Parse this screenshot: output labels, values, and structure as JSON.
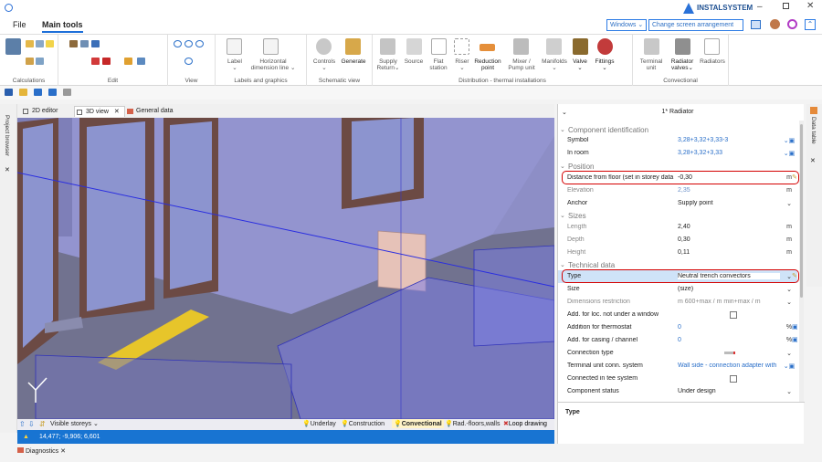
{
  "app": {
    "name": "INSTALSYSTEM"
  },
  "menu": {
    "file": "File",
    "main_tools": "Main tools",
    "windows": "Windows",
    "change_screen": "Change screen arrangement"
  },
  "ribbon": {
    "groups": [
      "Calculations",
      "Edit",
      "View",
      "Labels and graphics",
      "Schematic view",
      "Distribution - thermal installations",
      "Convectional"
    ],
    "buttons": {
      "label": "Label",
      "horizontal_dim_1": "Horizontal",
      "horizontal_dim_2": "dimension line",
      "controls": "Controls",
      "generate": "Generate",
      "supply_return_1": "Supply",
      "supply_return_2": "Return",
      "source": "Source",
      "flat_station_1": "Flat",
      "flat_station_2": "station",
      "riser": "Riser",
      "reduction_point_1": "Reduction",
      "reduction_point_2": "point",
      "mixer_1": "Mixer /",
      "mixer_2": "Pump unit",
      "manifolds": "Manifolds",
      "valve": "Valve",
      "fittings": "Fittings",
      "terminal_unit_1": "Terminal",
      "terminal_unit_2": "unit",
      "radiator_valves_1": "Radiator",
      "radiator_valves_2": "valves",
      "radiators": "Radiators"
    }
  },
  "tabs": [
    {
      "label": "2D editor"
    },
    {
      "label": "3D view"
    },
    {
      "label": "General data"
    }
  ],
  "left_panel": {
    "project_browser": "Project browser"
  },
  "right_panel": {
    "data_table": "Data table"
  },
  "viewport_status": {
    "visible_storeys": "Visible storeys",
    "layers": [
      "Underlay",
      "Construction",
      "Convectional",
      "Rad.-floors,walls",
      "Loop drawing"
    ]
  },
  "status_bar": {
    "coordinates": "14,477; -9,906; 6,601"
  },
  "diagnostics": {
    "label": "Diagnostics"
  },
  "properties": {
    "header": "1* Radiator",
    "sections": {
      "component_identification": "Component identification",
      "position": "Position",
      "sizes": "Sizes",
      "technical_data": "Technical data"
    },
    "rows": {
      "symbol": {
        "label": "Symbol",
        "value": "3,28+3,32+3,33-3"
      },
      "in_room": {
        "label": "In room",
        "value": "3,28+3,32+3,33"
      },
      "distance_from_floor": {
        "label": "Distance from floor (set in storey data",
        "value": "-0,30",
        "unit": "m"
      },
      "elevation": {
        "label": "Elevation",
        "value": "2,35",
        "unit": "m"
      },
      "anchor": {
        "label": "Anchor",
        "value": "Supply point"
      },
      "length": {
        "label": "Length",
        "value": "2,40",
        "unit": "m"
      },
      "depth": {
        "label": "Depth",
        "value": "0,30",
        "unit": "m"
      },
      "height": {
        "label": "Height",
        "value": "0,11",
        "unit": "m"
      },
      "type": {
        "label": "Type",
        "value": "Neutral trench convectors"
      },
      "size": {
        "label": "Size",
        "value": "(size)"
      },
      "dimensions_restriction": {
        "label": "Dimensions restriction",
        "value": "m 600+max / m min+max / m"
      },
      "add_loc": {
        "label": "Add. for loc. not under a window"
      },
      "addition_thermostat": {
        "label": "Addition for thermostat",
        "value": "0",
        "unit": "%"
      },
      "add_casing": {
        "label": "Add. for casing / channel",
        "value": "0",
        "unit": "%"
      },
      "connection_type": {
        "label": "Connection type"
      },
      "terminal_conn": {
        "label": "Terminal unit conn. system",
        "value": "Wall side - connection adapter with"
      },
      "connected_tee": {
        "label": "Connected in tee system"
      },
      "component_status": {
        "label": "Component status",
        "value": "Under design"
      }
    },
    "description_title": "Type"
  },
  "colors": {
    "accent": "#1e6fd9",
    "highlight_box": "#d40000",
    "viewport": "#8d8ec6",
    "status_blue": "#1874d2"
  }
}
